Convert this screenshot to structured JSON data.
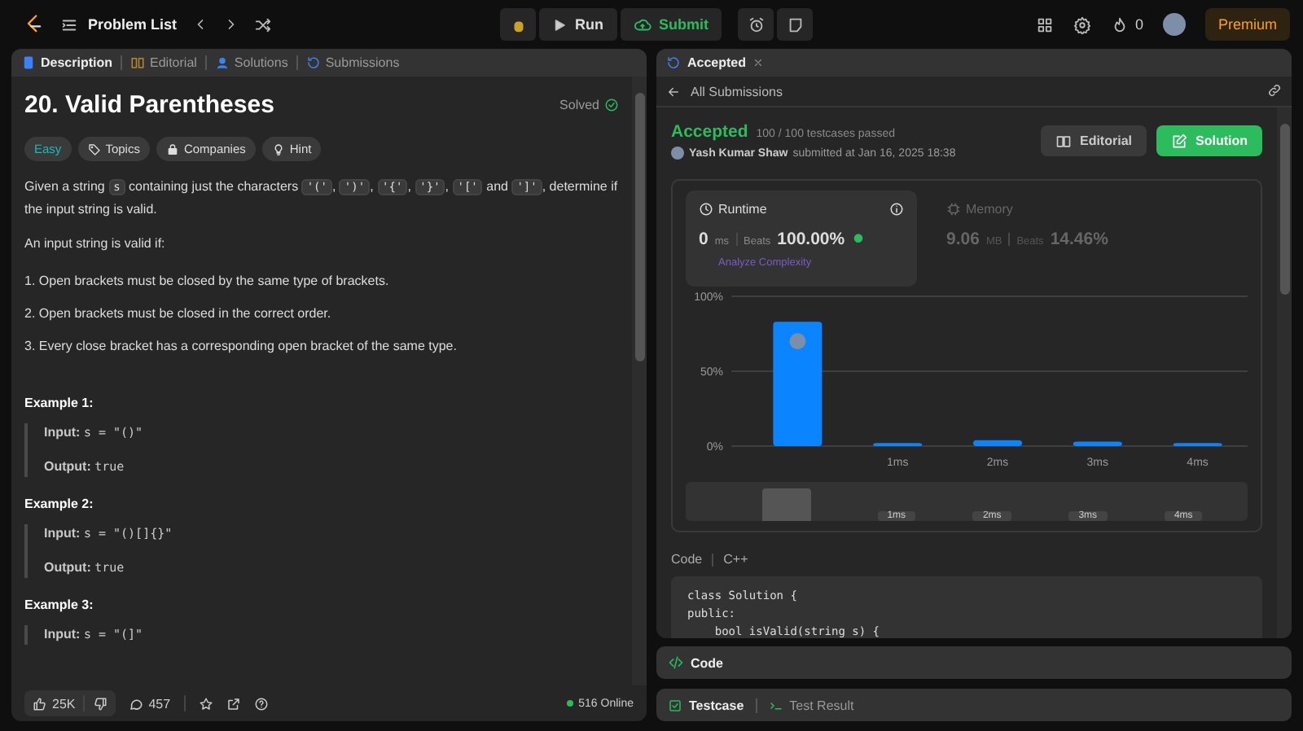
{
  "top_bar": {
    "title": "Problem List",
    "run": "Run",
    "submit": "Submit",
    "streak": "0",
    "premium": "Premium"
  },
  "description_tabs": [
    {
      "label": "Description",
      "selected": true
    },
    {
      "label": "Editorial",
      "selected": false
    },
    {
      "label": "Solutions",
      "selected": false
    },
    {
      "label": "Submissions",
      "selected": false
    }
  ],
  "problem": {
    "title": "20. Valid Parentheses",
    "status": "Solved",
    "difficulty": "Easy",
    "tags": [
      "Topics",
      "Companies",
      "Hint"
    ],
    "statement": [
      {
        "text": "Given a string "
      },
      {
        "code": "s"
      },
      {
        "text": " containing just the characters "
      },
      {
        "code": "'('"
      },
      {
        "text": ", "
      },
      {
        "code": "')'"
      },
      {
        "text": ", "
      },
      {
        "code": "'{'"
      },
      {
        "text": ", "
      },
      {
        "code": "'}'"
      },
      {
        "text": ", "
      },
      {
        "code": "'['"
      },
      {
        "text": " and "
      },
      {
        "code": "']'"
      },
      {
        "text": ", determine if the input string is valid."
      }
    ],
    "intro": "An input string is valid if:",
    "rules": [
      "1. Open brackets must be closed by the same type of brackets.",
      "2. Open brackets must be closed in the correct order.",
      "3. Every close bracket has a corresponding open bracket of the same type."
    ],
    "examples": [
      {
        "title": "Example 1:",
        "lines": [
          {
            "label": "Input:",
            "value": "s = \"()\""
          },
          {
            "label": "Output:",
            "value": "true"
          }
        ]
      },
      {
        "title": "Example 2:",
        "lines": [
          {
            "label": "Input:",
            "value": "s = \"()[]{}\""
          },
          {
            "label": "Output:",
            "value": "true"
          }
        ]
      },
      {
        "title": "Example 3:",
        "lines": [
          {
            "label": "Input:",
            "value": "s = \"(]\""
          }
        ]
      }
    ]
  },
  "footer": {
    "likes": "25K",
    "comments": "457",
    "online": "516 Online"
  },
  "result_tab": {
    "label": "Accepted",
    "back": "All Submissions"
  },
  "submission": {
    "status": "Accepted",
    "testcases": "100 / 100 testcases passed",
    "author": "Yash Kumar Shaw",
    "submitted": "submitted at Jan 16, 2025 18:38",
    "editorial": "Editorial",
    "solution": "Solution"
  },
  "metrics": [
    {
      "kind": "runtime",
      "label": "Runtime",
      "value": "0",
      "unit": "ms",
      "beats_label": "Beats",
      "beats": "100.00%",
      "selected": true,
      "link": "Analyze Complexity"
    },
    {
      "kind": "memory",
      "label": "Memory",
      "value": "9.06",
      "unit": "MB",
      "beats_label": "Beats",
      "beats": "14.46%",
      "selected": false
    }
  ],
  "chart_data": {
    "type": "bar",
    "categories": [
      null,
      "1ms",
      "2ms",
      "3ms",
      "4ms"
    ],
    "values": [
      83,
      2,
      4,
      3,
      2
    ],
    "ylim": [
      0,
      100
    ],
    "yticks": [
      {
        "value": 0,
        "label": "0%"
      },
      {
        "value": 50,
        "label": "50%"
      },
      {
        "value": 100,
        "label": "100%"
      }
    ]
  },
  "navigator": {
    "labels": [
      "1ms",
      "2ms",
      "3ms",
      "4ms"
    ]
  },
  "code": {
    "label": "Code",
    "language": "C++",
    "lines": [
      "class Solution {",
      "public:",
      "    bool isValid(string s) {"
    ]
  },
  "code_panel": {
    "label": "Code"
  },
  "testcase_tabs": [
    {
      "label": "Testcase",
      "selected": true
    },
    {
      "label": "Test Result",
      "selected": false
    }
  ]
}
